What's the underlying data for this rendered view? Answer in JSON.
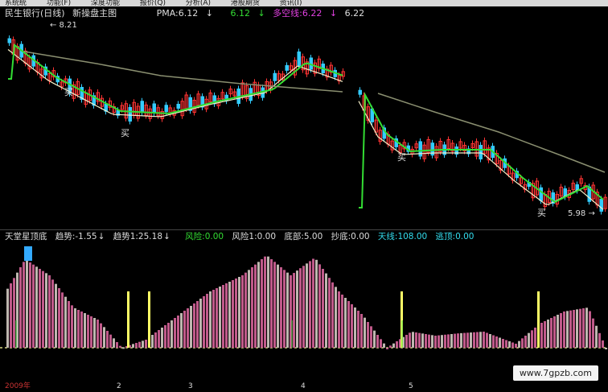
{
  "menu": {
    "items": [
      "系统统",
      "功能(F)",
      "深度功能",
      "报价(Q)",
      "分析(A)",
      "港股期货",
      "资讯(I)"
    ]
  },
  "header": {
    "stock": "民生银行(日线)",
    "template": "新操盘主图",
    "pma_label": "PMA:6.12",
    "pma_val": "6.12",
    "duokong_label": "多空线:6.22",
    "extra_val": "6.22"
  },
  "price_chart": {
    "high_label": "8.21",
    "low_label": "5.98",
    "buy_label": "买"
  },
  "indicator_bar": {
    "name": "天堂星顶底",
    "trend": "趋势:-1.55",
    "trend1": "趋势1:25.18",
    "risk": "风险:0.00",
    "risk1": "风险1:0.00",
    "bottom": "底部:5.00",
    "chaodi": "抄底:0.00",
    "tianxian": "天线:108.00",
    "taoding": "逃顶:0.00"
  },
  "date_axis": {
    "year": "2009年",
    "months": [
      "2",
      "3",
      "4",
      "5"
    ]
  },
  "watermark": "www.7gpzb.com",
  "colors": {
    "up": "#ff3333",
    "down": "#33ccff",
    "ma_white": "#f5f0c8",
    "ma_green": "#33dd33",
    "ma_gray": "#8a8f70",
    "ind_pink": "#c05a8a",
    "ind_gray": "#bfb7b0",
    "ind_magenta": "#e020e0",
    "ind_cyan": "#20d0d0",
    "ind_yellow": "#ffff66"
  }
}
